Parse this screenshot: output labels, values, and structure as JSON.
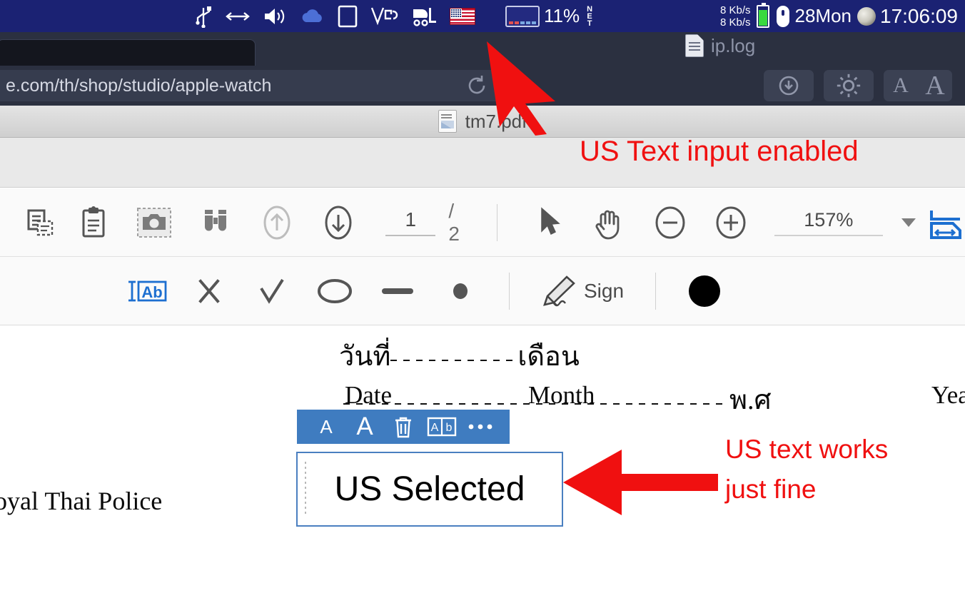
{
  "statusbar": {
    "icons": [
      "usb-icon",
      "arrows-horizontal-icon",
      "volume-icon",
      "cloud-icon",
      "square-icon",
      "vnc-icon",
      "forklift-icon",
      "us-flag-icon"
    ],
    "screen_icon": "screen-indicator-icon",
    "battery_percent": "11%",
    "net_label_lines": [
      "N",
      "E",
      "T"
    ],
    "net_up": "8 Kb/s",
    "net_down": "8 Kb/s",
    "battery_icon": "battery-icon",
    "mouse_icon": "mouse-icon",
    "date": "28Mon",
    "moon_icon": "moon-phase-icon",
    "clock": "17:06:09"
  },
  "browser": {
    "url": "e.com/th/shop/studio/apple-watch",
    "reload_icon": "reload-icon",
    "background_tab_label": "ip.log",
    "background_tab_icon": "log-file-icon",
    "buttons": [
      {
        "name": "download-button",
        "icon": "download-arrow-icon"
      },
      {
        "name": "settings-button",
        "icon": "gear-icon"
      },
      {
        "name": "decrease-font-button",
        "label": "A"
      },
      {
        "name": "increase-font-button",
        "label": "A"
      }
    ]
  },
  "pdf_tab": {
    "file_icon": "pdf-file-icon",
    "filename": "tm7.pdf"
  },
  "annotations": {
    "top_note": "US Text input enabled",
    "right_note_line1": "US text works",
    "right_note_line2": "just fine",
    "arrow_color": "#f01010"
  },
  "toolbar_main": {
    "items": [
      {
        "name": "copy-page-button",
        "icon": "copy-pages-icon"
      },
      {
        "name": "clipboard-button",
        "icon": "clipboard-icon"
      },
      {
        "name": "snapshot-button",
        "icon": "camera-icon"
      },
      {
        "name": "search-button",
        "icon": "binoculars-icon"
      },
      {
        "name": "previous-page-button",
        "icon": "arrow-up-circle-icon"
      },
      {
        "name": "next-page-button",
        "icon": "arrow-down-circle-icon"
      }
    ],
    "page_current": "1",
    "page_total": "/ 2",
    "select_tool": "cursor-arrow-icon",
    "pan_tool": "hand-icon",
    "zoom_out": "minus-circle-icon",
    "zoom_in": "plus-circle-icon",
    "zoom_level": "157%",
    "zoom_dropdown": "chevron-down-icon",
    "fit_width": "fit-width-icon"
  },
  "toolbar_annotate": {
    "items": [
      {
        "name": "text-tool-button",
        "icon": "text-insert-icon",
        "label": "Ab",
        "active": true
      },
      {
        "name": "cross-stamp-button",
        "icon": "x-mark-icon"
      },
      {
        "name": "check-stamp-button",
        "icon": "check-mark-icon"
      },
      {
        "name": "ellipse-tool-button",
        "icon": "ellipse-icon"
      },
      {
        "name": "line-tool-button",
        "icon": "line-icon"
      },
      {
        "name": "dot-tool-button",
        "icon": "filled-dot-icon"
      }
    ],
    "sign_icon": "pen-sign-icon",
    "sign_label": "Sign",
    "color_swatch": "#000000",
    "color_swatch_name": "color-swatch-black"
  },
  "document": {
    "thai_date_label": "วันที่",
    "thai_month_label": "เดือน",
    "thai_year_label": "พ.ศ",
    "en_date_label": "Date",
    "en_month_label": "Month",
    "en_year_label": "Yea",
    "footer_text": "oyal Thai Police"
  },
  "text_annotation": {
    "popup_buttons": [
      {
        "name": "decrease-text-size-button",
        "label": "A"
      },
      {
        "name": "increase-text-size-button",
        "label": "A"
      },
      {
        "name": "delete-annotation-button",
        "icon": "trash-icon"
      },
      {
        "name": "edit-text-button",
        "icon": "ab-box-icon",
        "label": "Ab"
      },
      {
        "name": "more-options-button",
        "icon": "ellipsis-icon"
      }
    ],
    "popup_bg": "#3f7cc0",
    "content": "US Selected",
    "border_color": "#4a7fc0"
  }
}
